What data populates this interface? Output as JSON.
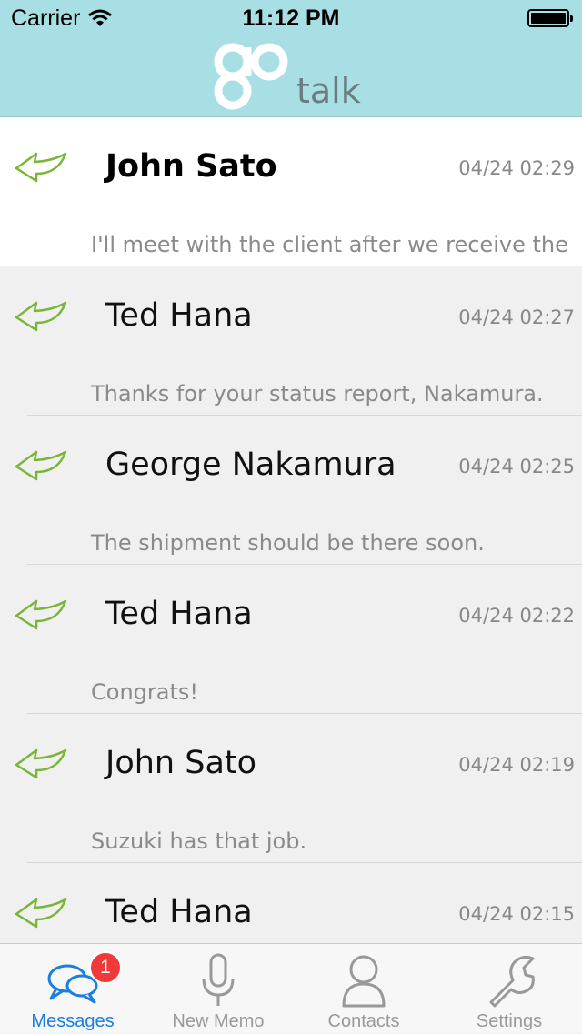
{
  "status_bar": {
    "carrier": "Carrier",
    "time": "11:12 PM"
  },
  "header": {
    "logo_text": "talk",
    "logo_icon": "go-logo-icon",
    "background": "#a8dfe4"
  },
  "messages": [
    {
      "name": "John Sato",
      "time": "04/24 02:29",
      "preview": "I'll meet with the client after we receive the",
      "unread": true
    },
    {
      "name": "Ted Hana",
      "time": "04/24 02:27",
      "preview": "Thanks for your status report, Nakamura.",
      "unread": false
    },
    {
      "name": "George Nakamura",
      "time": "04/24 02:25",
      "preview": "The shipment should be there soon.",
      "unread": false
    },
    {
      "name": "Ted Hana",
      "time": "04/24 02:22",
      "preview": "Congrats!",
      "unread": false
    },
    {
      "name": "John Sato",
      "time": "04/24 02:19",
      "preview": "Suzuki has that job.",
      "unread": false
    },
    {
      "name": "Ted Hana",
      "time": "04/24 02:15",
      "preview": "",
      "unread": false
    }
  ],
  "tabbar": {
    "tabs": [
      {
        "label": "Messages",
        "icon": "chat-bubbles-icon",
        "badge": "1",
        "active": true
      },
      {
        "label": "New Memo",
        "icon": "microphone-icon",
        "active": false
      },
      {
        "label": "Contacts",
        "icon": "person-icon",
        "active": false
      },
      {
        "label": "Settings",
        "icon": "wrench-icon",
        "active": false
      }
    ]
  },
  "colors": {
    "accent": "#1a7fe0",
    "reply_icon": "#7ab53a",
    "badge": "#f03a3a"
  }
}
